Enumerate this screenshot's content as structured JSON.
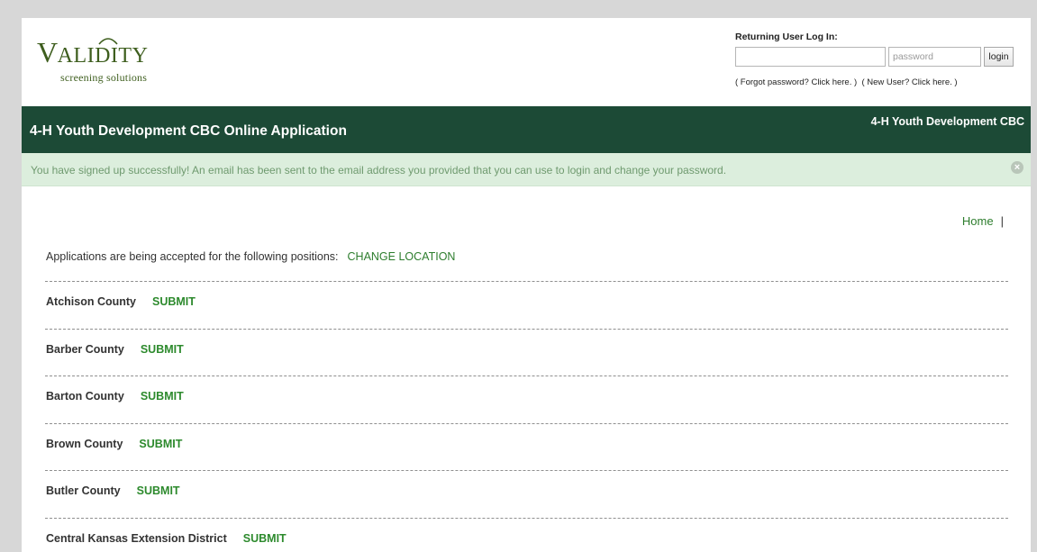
{
  "logo": {
    "word_big": "V",
    "word_small": "ALIDITY",
    "tagline": "screening solutions"
  },
  "login": {
    "title": "Returning User Log In:",
    "username_value": "",
    "password_placeholder": "password",
    "button_label": "login",
    "forgot_link": "( Forgot password? Click here. )",
    "new_user_link": "( New User? Click here. )"
  },
  "titlebar": {
    "main_title": "4-H Youth Development CBC Online Application",
    "right_title": "4-H Youth Development CBC"
  },
  "alert": {
    "message": "You have signed up successfully! An email has been sent to the email address you provided that you can use to login and change your password.",
    "close_symbol": "×"
  },
  "nav": {
    "home_label": "Home",
    "separator": "|"
  },
  "main": {
    "intro_text": "Applications are being accepted for the following positions:",
    "change_location_label": "CHANGE LOCATION",
    "submit_label": "SUBMIT",
    "positions": [
      "Atchison County",
      "Barber County",
      "Barton County",
      "Brown County",
      "Butler County",
      "Central Kansas Extension District"
    ]
  },
  "colors": {
    "header_green": "#1c4a36",
    "link_green": "#2d7d2d",
    "alert_bg": "#dceedd",
    "alert_text": "#6f9a6f",
    "page_bg": "#d7d7d7"
  }
}
